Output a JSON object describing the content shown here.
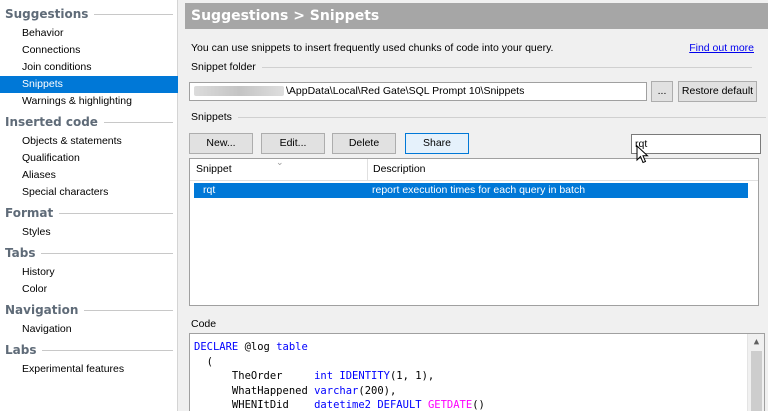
{
  "nav": {
    "sections": [
      {
        "title": "Suggestions",
        "items": [
          "Behavior",
          "Connections",
          "Join conditions",
          "Snippets",
          "Warnings & highlighting"
        ]
      },
      {
        "title": "Inserted code",
        "items": [
          "Objects & statements",
          "Qualification",
          "Aliases",
          "Special characters"
        ]
      },
      {
        "title": "Format",
        "items": [
          "Styles"
        ]
      },
      {
        "title": "Tabs",
        "items": [
          "History",
          "Color"
        ]
      },
      {
        "title": "Navigation",
        "items": [
          "Navigation"
        ]
      },
      {
        "title": "Labs",
        "items": [
          "Experimental features"
        ]
      }
    ],
    "selected": "Snippets"
  },
  "content": {
    "title": "Suggestions > Snippets",
    "description": "You can use snippets to insert frequently used chunks of code into your query.",
    "find_out_more": "Find out more",
    "snippet_folder_label": "Snippet folder",
    "folder_path": "\\AppData\\Local\\Red Gate\\SQL Prompt 10\\Snippets",
    "browse_label": "...",
    "restore_default_label": "Restore default",
    "snippets_label": "Snippets",
    "buttons": {
      "new": "New...",
      "edit": "Edit...",
      "delete": "Delete",
      "share": "Share"
    },
    "search_value": "rqt",
    "grid": {
      "columns": [
        "Snippet",
        "Description"
      ],
      "rows": [
        {
          "snippet": "rqt",
          "description": "report execution times for each query in batch"
        }
      ]
    },
    "code_label": "Code",
    "code_lines": [
      "DECLARE @log table",
      "  (",
      "      TheOrder     int IDENTITY(1, 1),",
      "      WhatHappened varchar(200),",
      "      WHENItDid    datetime2 DEFAULT GETDATE()"
    ]
  },
  "colors": {
    "selection": "#0078d7",
    "title_bar": "#a6a6a6",
    "keyword": "#0000ff",
    "function": "#ff00ff",
    "link": "#0000ee"
  }
}
